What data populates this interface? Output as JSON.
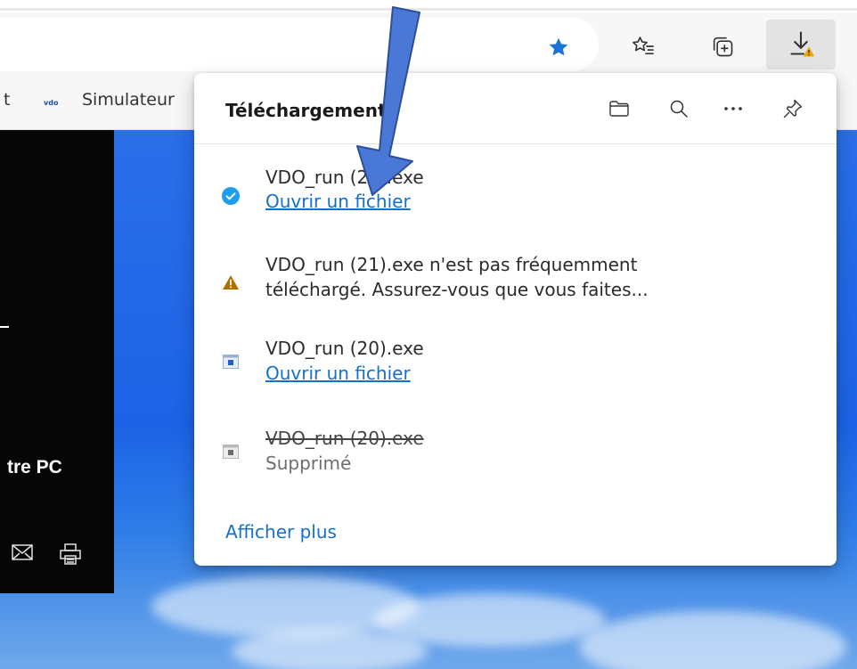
{
  "favorites_bar": {
    "partial_left_text": "t",
    "item_label": "Simulateur"
  },
  "toolbar": {
    "icons": [
      "favorite-star-icon",
      "favorites-list-icon",
      "collections-icon",
      "downloads-icon"
    ],
    "accent_color": "#1470c8",
    "warning_color": "#f2a900"
  },
  "downloads": {
    "title": "Téléchargements",
    "header_icons": [
      "folder-icon",
      "search-icon",
      "more-icon",
      "pin-icon"
    ],
    "items": [
      {
        "name": "VDO_run (22).exe",
        "action": "Ouvrir un fichier",
        "status_icon": "check-circle-icon"
      },
      {
        "line1": "VDO_run (21).exe n'est pas fréquemment",
        "line2": "téléchargé. Assurez-vous que vous faites...",
        "status_icon": "warning-icon"
      },
      {
        "name": "VDO_run (20).exe",
        "action": "Ouvrir un fichier",
        "status_icon": "exe-file-icon"
      },
      {
        "name": "VDO_run (20).exe",
        "status": "Supprimé",
        "status_icon": "exe-file-deleted-icon"
      }
    ],
    "show_more": "Afficher plus"
  },
  "page": {
    "panel_text": "tre PC"
  }
}
